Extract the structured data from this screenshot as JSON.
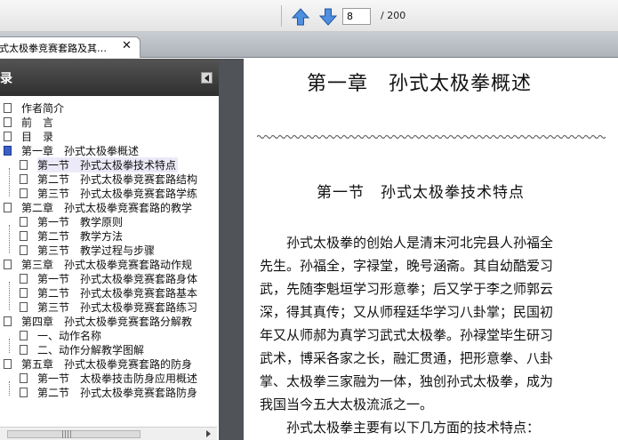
{
  "toolbar": {
    "page_value": "8",
    "page_total": "/ 200",
    "icons": [
      "arrow-up-icon",
      "arrow-down-icon"
    ]
  },
  "tab": {
    "title": "式太极拳竞赛套路及其…",
    "close": "✕"
  },
  "sidebar": {
    "title": "录",
    "items": [
      {
        "label": "作者简介"
      },
      {
        "label": "前　言"
      },
      {
        "label": "目　录"
      },
      {
        "label": "第一章　孙式太极拳概述"
      },
      {
        "label": "第一节　孙式太极拳技术特点"
      },
      {
        "label": "第二节　孙式太极拳竞赛套路结构"
      },
      {
        "label": "第三节　孙式太极拳竞赛套路学练"
      },
      {
        "label": "第二章　孙式太极拳竞赛套路的教学"
      },
      {
        "label": "第一节　教学原则"
      },
      {
        "label": "第二节　教学方法"
      },
      {
        "label": "第三节　教学过程与步骤"
      },
      {
        "label": "第三章　孙式太极拳竞赛套路动作规"
      },
      {
        "label": "第一节　孙式太极拳竞赛套路身体"
      },
      {
        "label": "第二节　孙式太极拳竞赛套路基本"
      },
      {
        "label": "第三节　孙式太极拳竞赛套路练习"
      },
      {
        "label": "第四章　孙式太极拳竞赛套路分解教"
      },
      {
        "label": "一、动作名称"
      },
      {
        "label": "二、动作分解教学图解"
      },
      {
        "label": "第五章　孙式太极拳竞赛套路的防身"
      },
      {
        "label": "第一节　太极拳技击防身应用概述"
      },
      {
        "label": "第二节　孙式太极拳竞赛套路防身"
      }
    ]
  },
  "page": {
    "chapter_title": "第一章　孙式太极拳概述",
    "section_title": "第一节　孙式太极拳技术特点",
    "lines": [
      "　　孙式太极拳的创始人是清末河北完县人孙福全",
      "先生。孙福全，字禄堂，晚号涵斋。其自幼酷爱习",
      "武，先随李魁垣学习形意拳；后又学于李之师郭云",
      "深，得其真传；又从师程廷华学习八卦掌；民国初",
      "年又从师郝为真学习武式太极拳。孙禄堂毕生研习",
      "武术，博采各家之长，融汇贯通，把形意拳、八卦",
      "掌、太极拳三家融为一体，独创孙式太极拳，成为",
      "我国当今五大太极流派之一。",
      "　　孙式太极拳主要有以下几方面的技术特点："
    ]
  }
}
